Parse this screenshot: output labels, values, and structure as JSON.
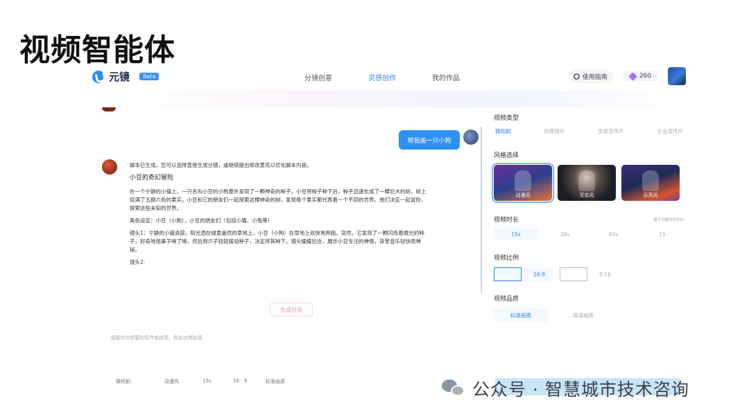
{
  "slide": {
    "title": "视频智能体"
  },
  "app": {
    "logo_text": "元镜",
    "beta_label": "Beta",
    "nav": [
      {
        "label": "分镜创意",
        "active": false
      },
      {
        "label": "灵感创作",
        "active": true
      },
      {
        "label": "我的作品",
        "active": false
      }
    ],
    "guide_label": "使用指南",
    "credits": "260"
  },
  "chat": {
    "user_message": "帮我画一只小狗",
    "ai_intro": "脚本已生成，您可以选择直接生成分镜，或继续提出修改意见以优化脚本内容。",
    "story_title": "小豆的奇幻冒险",
    "paragraph1": "在一个宁静的小镇上，一只名叫小豆的小狗意外发现了一颗神奇的种子。小豆将种子种下后，种子迅速长成了一棵巨大的树，树上结满了五颜六色的果实。小豆和它的朋友们一起探索这棵神奇的树，发现每个果实都代表着一个不同的世界。他们决定一起冒险，探索这些未知的世界。",
    "paragraph2": "角色设定：小豆（小狗），小豆的朋友们（包括小猫、小兔等）",
    "paragraph3": "镜头1：宁静的小镇清晨，阳光洒在绿意盎然的草地上，小豆（小狗）在草地上欢快地奔跑。突然，它发现了一颗闪烁着微光的种子，好奇地用鼻子嗅了嗅，然后用爪子轻轻拨动种子，决定将其种下。镜头缓缓拉近，展示小豆专注的神情，背景音乐轻快而神秘。",
    "paragraph4": "镜头2:",
    "generate_button": "生成分镜",
    "input_placeholder": "请描述你想要的情节或故事，即刻点燃创意"
  },
  "bottom_bar": [
    "微短剧",
    "动漫风",
    "15s",
    "16 : 9",
    "标准画质"
  ],
  "settings": {
    "video_type": {
      "label": "视频类型",
      "options": [
        "微短剧",
        "创意短片",
        "文旅宣传片",
        "企业宣传片"
      ],
      "selected": 0
    },
    "style": {
      "label": "风格选择",
      "options": [
        "动漫风",
        "写实风",
        "乐高风"
      ],
      "selected": 0
    },
    "duration": {
      "label": "视频时长",
      "hint": "每个分镜头时长5s",
      "options": [
        "15s",
        "30s",
        "60s",
        "15"
      ],
      "selected": 0
    },
    "ratio": {
      "label": "视频比例",
      "options": [
        "16:9",
        "9:16"
      ],
      "selected": 0
    },
    "quality": {
      "label": "视频品质",
      "options": [
        "标准画质",
        "高清画质"
      ],
      "selected": 0
    }
  },
  "watermark": {
    "text": "公众号 · 智慧城市技术咨询"
  },
  "colors": {
    "accent": "#2f7ff0",
    "user_bubble": "#2e90f5",
    "beta": "#3c8ff7"
  }
}
